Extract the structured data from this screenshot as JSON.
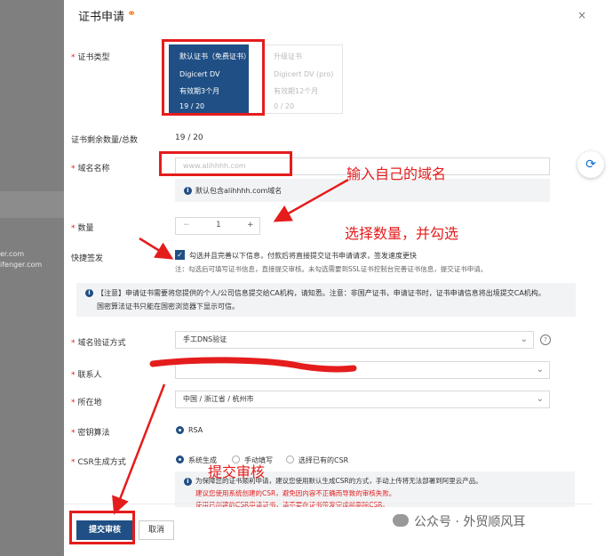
{
  "background": {
    "lines": [
      "er.com",
      "ifenger.com"
    ]
  },
  "dialog": {
    "title": "证书申请",
    "close": "×"
  },
  "form": {
    "cert_type": {
      "label": "证书类型",
      "options": [
        {
          "name": "默认证书（免费证书）",
          "product": "Digicert DV",
          "validity": "有效期3个月",
          "count": "19 / 20"
        },
        {
          "name": "升级证书",
          "product": "Digicert DV (pro)",
          "validity": "有效期12个月",
          "count": "0 / 20"
        }
      ]
    },
    "remaining": {
      "label": "证书剩余数量/总数",
      "value": "19 / 20"
    },
    "domain": {
      "label": "域名名称",
      "placeholder": "www.alihhhh.com",
      "hint": "默认包含alihhhh.com域名"
    },
    "quantity": {
      "label": "数量",
      "minus": "−",
      "value": "1",
      "plus": "+"
    },
    "express": {
      "label": "快捷签发",
      "check": "✓",
      "text": "勾选并且完善以下信息，付款后将直接提交证书申请请求，签发速度更快",
      "note": "注：勾选后可填写证书信息，直接提交审核。未勾选需要到SSL证书控制台完善证书信息，提交证书申请。"
    },
    "notice": [
      "【注意】申请证书需要将您提供的个人/公司信息提交给CA机构，请知悉。注意：非国产证书，申请证书时，证书申请信息将出境提交CA机构。",
      "国密算法证书只能在国密浏览器下显示可信。"
    ],
    "verify_method": {
      "label": "域名验证方式",
      "value": "手工DNS验证",
      "help": "?"
    },
    "contact": {
      "label": "联系人",
      "value": ""
    },
    "location": {
      "label": "所在地",
      "value": "中国 / 浙江省 / 杭州市"
    },
    "key_algo": {
      "label": "密钥算法",
      "option": "RSA"
    },
    "csr": {
      "label": "CSR生成方式",
      "options": [
        "系统生成",
        "手动填写",
        "选择已有的CSR"
      ],
      "hint": [
        "为保障您的证书顺利申请，建议您使用默认生成CSR的方式，手动上传将无法部署到阿里云产品。",
        "建议您使用系统创建的CSR，避免因内容不正确而导致的审核失败。",
        "使用已创建的CSR申请证书，请不要在证书签发完成前删除CSR。"
      ]
    }
  },
  "footer": {
    "submit": "提交审核",
    "cancel": "取消"
  },
  "annotations": {
    "domain": "输入自己的域名",
    "quantity": "选择数量，并勾选",
    "submit": "提交审核"
  },
  "watermark": "公众号 · 外贸顺风耳",
  "colors": {
    "primary": "#1f4f84",
    "annotation": "#e51c1c",
    "required": "#e02020"
  }
}
